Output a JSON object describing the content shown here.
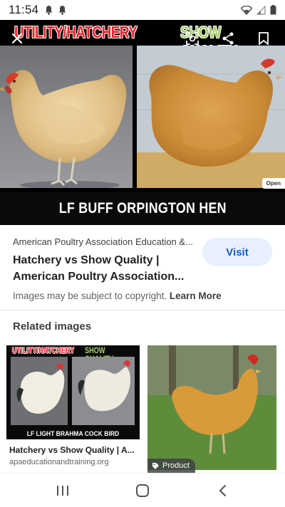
{
  "status_bar": {
    "time": "11:54",
    "notification_icons": [
      "bell-icon",
      "bell-icon"
    ],
    "system_icons": [
      "wifi-icon",
      "signal-icon",
      "battery-icon"
    ]
  },
  "hero": {
    "title_left": "UTILITY/HATCHERY",
    "title_right": "SHOW QUALITY",
    "caption": "LF BUFF ORPINGTON HEN",
    "open_label": "Open"
  },
  "result": {
    "source": "American Poultry Association Education &...",
    "title": "Hatchery vs Show Quality | American Poultry Association...",
    "visit_label": "Visit",
    "copyright_text": "Images may be subject to copyright.",
    "learn_more": "Learn More"
  },
  "related": {
    "heading": "Related images",
    "items": [
      {
        "thumb_title_left": "UTILITY/HATCHERY",
        "thumb_title_right": "SHOW QUALITY",
        "thumb_caption": "LF LIGHT BRAHMA COCK BIRD",
        "title": "Hatchery vs Show Quality | A...",
        "source": "apaeducationandtraining.org"
      },
      {
        "chip_label": "Product"
      }
    ]
  },
  "colors": {
    "title_red": "#e8262b",
    "title_green": "#a8d06a",
    "visit_bg": "#e8f0fe",
    "visit_text": "#1a5fb4"
  }
}
